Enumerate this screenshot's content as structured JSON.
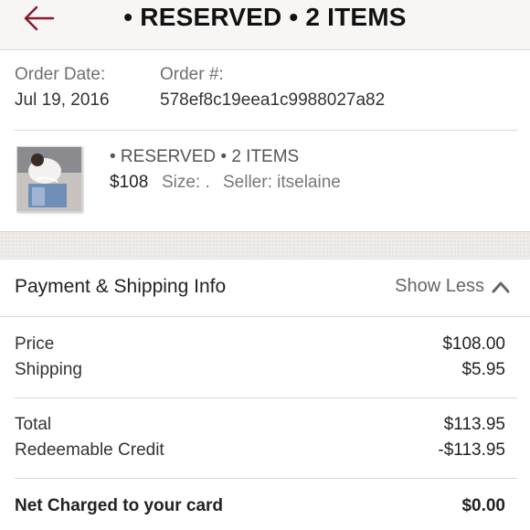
{
  "header": {
    "title": "• RESERVED • 2 ITEMS",
    "back_icon": "arrow-left-icon",
    "accent_color": "#8b1a2b"
  },
  "order": {
    "date_label": "Order Date:",
    "date_value": "Jul 19, 2016",
    "number_label": "Order #:",
    "number_value": "578ef8c19eea1c9988027a82"
  },
  "item": {
    "title": "• RESERVED • 2 ITEMS",
    "price": "$108",
    "size": "Size: .",
    "seller": "Seller: itselaine",
    "thumb_icon": "product-thumbnail"
  },
  "payment": {
    "title": "Payment & Shipping Info",
    "toggle_label": "Show Less",
    "toggle_icon": "chevron-up-icon",
    "lines": [
      {
        "label": "Price",
        "value": "$108.00"
      },
      {
        "label": "Shipping",
        "value": "$5.95"
      },
      {
        "label": "Total",
        "value": "$113.95"
      },
      {
        "label": "Redeemable Credit",
        "value": "-$113.95"
      }
    ],
    "net_label": "Net Charged to your card",
    "net_value": "$0.00"
  }
}
